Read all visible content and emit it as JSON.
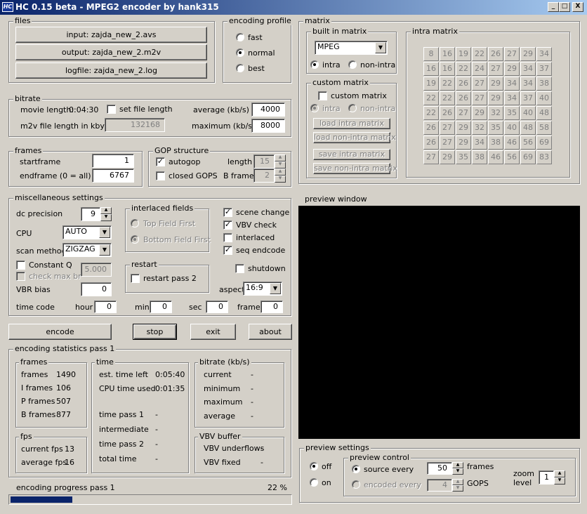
{
  "title": "HC 0.15 beta - MPEG2 encoder by hank315",
  "app_icon": "HC",
  "window_buttons": [
    "_",
    "□",
    "X"
  ],
  "files": {
    "label": "files",
    "input": "input: zajda_new_2.avs",
    "output": "output: zajda_new_2.m2v",
    "logfile": "logfile: zajda_new_2.log"
  },
  "profile": {
    "label": "encoding profile",
    "options": [
      "fast",
      "normal",
      "best"
    ],
    "selected": 1
  },
  "bitrate": {
    "label": "bitrate",
    "movie_length_label": "movie length:",
    "movie_length": "0:04:30",
    "set_file_length": "set file length",
    "m2v_label": "m2v file length in kbytes",
    "m2v_value": "132168",
    "average_label": "average (kb/s)",
    "average": "4000",
    "maximum_label": "maximum (kb/s)",
    "maximum": "8000"
  },
  "frames": {
    "label": "frames",
    "start_label": "startframe",
    "start": "1",
    "end_label": "endframe (0 = all)",
    "end": "6767"
  },
  "gop": {
    "label": "GOP structure",
    "autogop": "autogop",
    "closed": "closed GOPS",
    "length_label": "length",
    "length": "15",
    "bframes_label": "B frames",
    "bframes": "2"
  },
  "matrix": {
    "label": "matrix",
    "builtin_label": "built in matrix",
    "builtin_value": "MPEG",
    "intra": "intra",
    "nonintra": "non-intra",
    "custom_label": "custom matrix",
    "custom_chk": "custom matrix",
    "c_intra": "intra",
    "c_nonintra": "non-intra",
    "load_intra": "load intra matrix",
    "load_nonintra": "load non-intra matrix",
    "save_intra": "save intra matrix",
    "save_nonintra": "save non-intra matrix",
    "intra_matrix_label": "intra matrix",
    "values": [
      [
        8,
        16,
        19,
        22,
        26,
        27,
        29,
        34
      ],
      [
        16,
        16,
        22,
        24,
        27,
        29,
        34,
        37
      ],
      [
        19,
        22,
        26,
        27,
        29,
        34,
        34,
        38
      ],
      [
        22,
        22,
        26,
        27,
        29,
        34,
        37,
        40
      ],
      [
        22,
        26,
        27,
        29,
        32,
        35,
        40,
        48
      ],
      [
        26,
        27,
        29,
        32,
        35,
        40,
        48,
        58
      ],
      [
        26,
        27,
        29,
        34,
        38,
        46,
        56,
        69
      ],
      [
        27,
        29,
        35,
        38,
        46,
        56,
        69,
        83
      ]
    ]
  },
  "misc": {
    "label": "miscellaneous settings",
    "dc_label": "dc precision",
    "dc": "9",
    "cpu_label": "CPU",
    "cpu": "AUTO",
    "scan_label": "scan method",
    "scan": "ZIGZAG",
    "constq": "Constant Q",
    "checkmax": "check max br",
    "q_value": "5.000",
    "vbr_label": "VBR bias",
    "vbr": "0",
    "interlaced_label": "interlaced fields",
    "top_first": "Top Field First",
    "bottom_first": "Bottom Field First",
    "restart_label": "restart",
    "restart_pass2": "restart pass 2",
    "scene_change": "scene change",
    "vbv_check": "VBV check",
    "interlaced": "interlaced",
    "seq_endcode": "seq endcode",
    "shutdown": "shutdown",
    "aspect_label": "aspect",
    "aspect": "16:9",
    "timecode_label": "time code",
    "hour_label": "hour",
    "hour": "0",
    "min_label": "min",
    "min": "0",
    "sec_label": "sec",
    "sec": "0",
    "frame_label": "frame",
    "frame": "0"
  },
  "actions": {
    "encode": "encode",
    "stop": "stop",
    "exit": "exit",
    "about": "about"
  },
  "stats": {
    "label": "encoding statistics pass 1",
    "frames_label": "frames",
    "frames_rows": [
      [
        "frames",
        "1490"
      ],
      [
        "I frames",
        "106"
      ],
      [
        "P frames",
        "507"
      ],
      [
        "B frames",
        "877"
      ]
    ],
    "fps_label": "fps",
    "fps_rows": [
      [
        "current fps",
        "13"
      ],
      [
        "average fps",
        "16"
      ]
    ],
    "time_label": "time",
    "time_rows": [
      [
        "est. time left",
        "0:05:40"
      ],
      [
        "CPU time used",
        "0:01:35"
      ]
    ],
    "time_rows2": [
      [
        "time pass 1",
        "-"
      ],
      [
        "intermediate",
        "-"
      ],
      [
        "time pass 2",
        "-"
      ],
      [
        "total time",
        "-"
      ]
    ],
    "bitrate_label": "bitrate (kb/s)",
    "bitrate_rows": [
      [
        "current",
        "-"
      ],
      [
        "minimum",
        "-"
      ],
      [
        "maximum",
        "-"
      ],
      [
        "average",
        "-"
      ]
    ],
    "vbv_label": "VBV buffer",
    "vbv_rows": [
      [
        "VBV underflows",
        "-"
      ],
      [
        "VBV  fixed",
        "-"
      ]
    ]
  },
  "progress": {
    "label": "encoding progress",
    "pass": "pass 1",
    "percent_text": "22 %",
    "percent": 22
  },
  "preview": {
    "label": "preview window"
  },
  "preview_settings": {
    "label": "preview settings",
    "off": "off",
    "on": "on",
    "control_label": "preview control",
    "source_every": "source  every",
    "source_value": "50",
    "frames": "frames",
    "encoded_every": "encoded every",
    "encoded_value": "4",
    "gops": "GOPS",
    "zoom_label": "zoom level",
    "zoom": "1"
  }
}
